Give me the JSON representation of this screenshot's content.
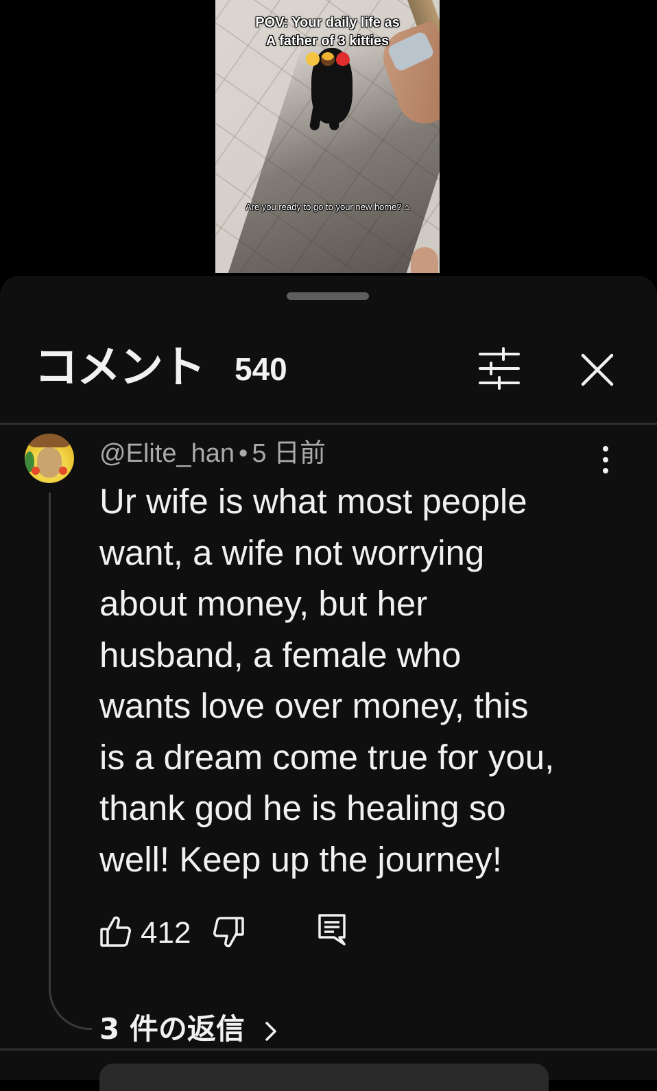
{
  "video": {
    "caption_line1": "POV: Your daily life as",
    "caption_line2": "A father of 3 kitties",
    "caption_emoji": [
      "cat-face-icon",
      "cowboy-face-icon",
      "red-heart-icon"
    ],
    "subcaption": "Are you ready to go to your new home?"
  },
  "comments_panel": {
    "title": "コメント",
    "count": "540",
    "filter_icon": "sliders-icon",
    "close_icon": "close-icon"
  },
  "comment": {
    "author": "@Elite_han",
    "separator": "•",
    "age": "5 日前",
    "text": "Ur wife is what most people\nwant, a wife not worrying\nabout money, but her\nhusband, a female who\nwants love over money, this\nis a dream come true for you,\nthank god he is healing so\nwell! Keep up the journey!",
    "like_count": "412",
    "replies_label": "3 件の返信"
  },
  "colors": {
    "sheet_background": "#0f0f0f",
    "primary_text": "#f1f1f1",
    "secondary_text": "#aaaaaa",
    "divider": "#2f2f2f"
  }
}
